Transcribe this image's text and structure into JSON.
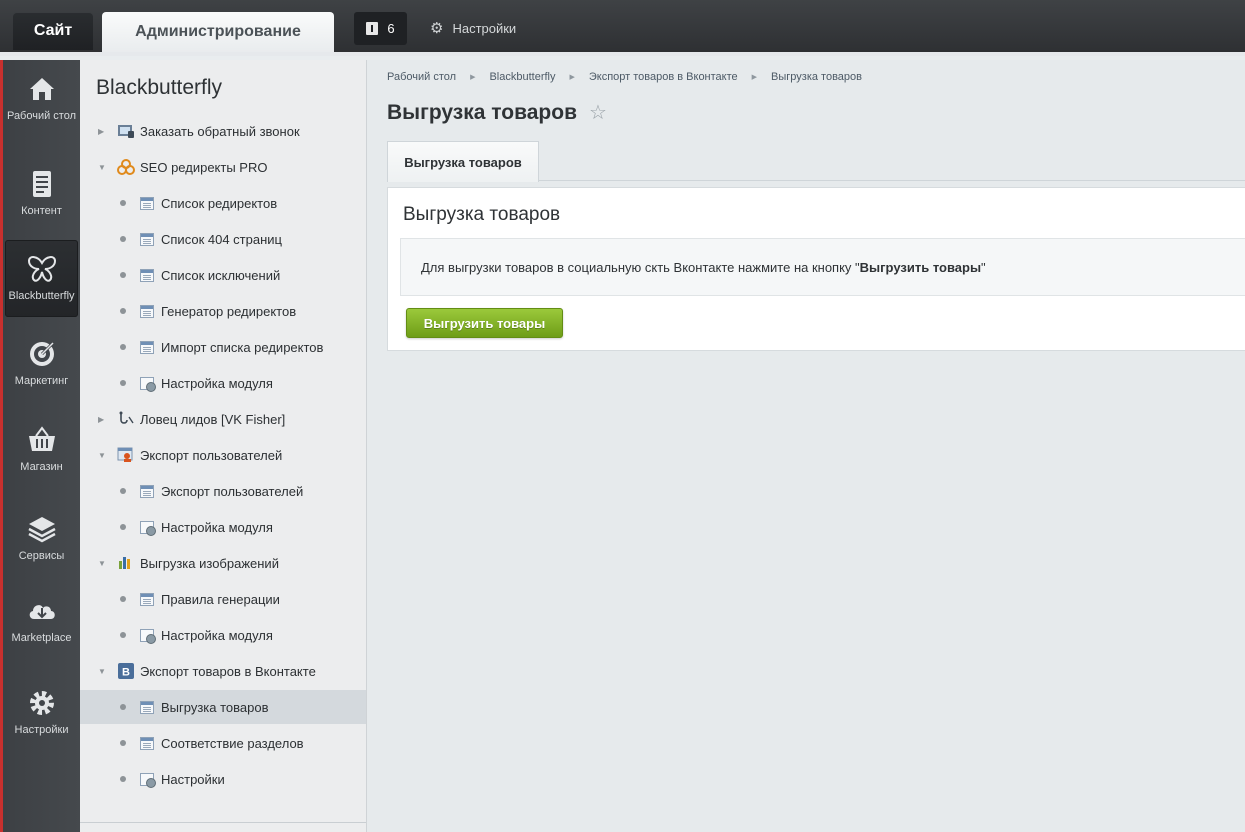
{
  "topbar": {
    "site_tab": "Сайт",
    "admin_tab": "Администрирование",
    "notifications_count": "6",
    "settings_label": "Настройки"
  },
  "rail": {
    "items": [
      {
        "label": "Рабочий стол",
        "icon": "home-icon"
      },
      {
        "label": "Контент",
        "icon": "document-icon"
      },
      {
        "label": "Blackbutterfly",
        "icon": "butterfly-icon",
        "active": true
      },
      {
        "label": "Маркетинг",
        "icon": "target-icon"
      },
      {
        "label": "Магазин",
        "icon": "basket-icon"
      },
      {
        "label": "Сервисы",
        "icon": "layers-icon"
      },
      {
        "label": "Marketplace",
        "icon": "cloud-download-icon"
      },
      {
        "label": "Настройки",
        "icon": "gear-icon"
      }
    ]
  },
  "sidebar": {
    "title": "Blackbutterfly",
    "items": [
      {
        "label": "Заказать обратный звонок",
        "level": 0,
        "expanded": false,
        "icon": "callback-icon"
      },
      {
        "label": "SEO редиректы PRO",
        "level": 0,
        "expanded": true,
        "icon": "seo-icon"
      },
      {
        "label": "Список редиректов",
        "level": 1,
        "icon": "page-icon"
      },
      {
        "label": "Список 404 страниц",
        "level": 1,
        "icon": "page-icon"
      },
      {
        "label": "Список исключений",
        "level": 1,
        "icon": "page-icon"
      },
      {
        "label": "Генератор редиректов",
        "level": 1,
        "icon": "page-icon"
      },
      {
        "label": "Импорт списка редиректов",
        "level": 1,
        "icon": "page-icon"
      },
      {
        "label": "Настройка модуля",
        "level": 1,
        "icon": "settings-page-icon"
      },
      {
        "label": "Ловец лидов [VK Fisher]",
        "level": 0,
        "expanded": false,
        "icon": "fishing-hook-icon"
      },
      {
        "label": "Экспорт пользователей",
        "level": 0,
        "expanded": true,
        "icon": "users-export-icon"
      },
      {
        "label": "Экспорт пользователей",
        "level": 1,
        "icon": "page-icon"
      },
      {
        "label": "Настройка модуля",
        "level": 1,
        "icon": "settings-page-icon"
      },
      {
        "label": "Выгрузка изображений",
        "level": 0,
        "expanded": true,
        "icon": "images-icon"
      },
      {
        "label": "Правила генерации",
        "level": 1,
        "icon": "page-icon"
      },
      {
        "label": "Настройка модуля",
        "level": 1,
        "icon": "settings-page-icon"
      },
      {
        "label": "Экспорт товаров в Вконтакте",
        "level": 0,
        "expanded": true,
        "icon": "vk-icon"
      },
      {
        "label": "Выгрузка товаров",
        "level": 1,
        "icon": "page-icon",
        "active": true
      },
      {
        "label": "Соответствие разделов",
        "level": 1,
        "icon": "page-icon"
      },
      {
        "label": "Настройки",
        "level": 1,
        "icon": "settings-page-icon"
      }
    ]
  },
  "main": {
    "breadcrumb": [
      "Рабочий стол",
      "Blackbutterfly",
      "Экспорт товаров в Вконтакте",
      "Выгрузка товаров"
    ],
    "page_title": "Выгрузка товаров",
    "tab_label": "Выгрузка товаров",
    "panel_title": "Выгрузка товаров",
    "note_prefix": "Для выгрузки товаров в социальную скть Вконтакте нажмите на кнопку \"",
    "note_bold": "Выгрузить товары",
    "note_suffix": "\"",
    "export_button": "Выгрузить товары"
  },
  "colors": {
    "accent_red": "#c8302e",
    "button_green": "#7fb01f",
    "rail_bg": "#414549"
  }
}
